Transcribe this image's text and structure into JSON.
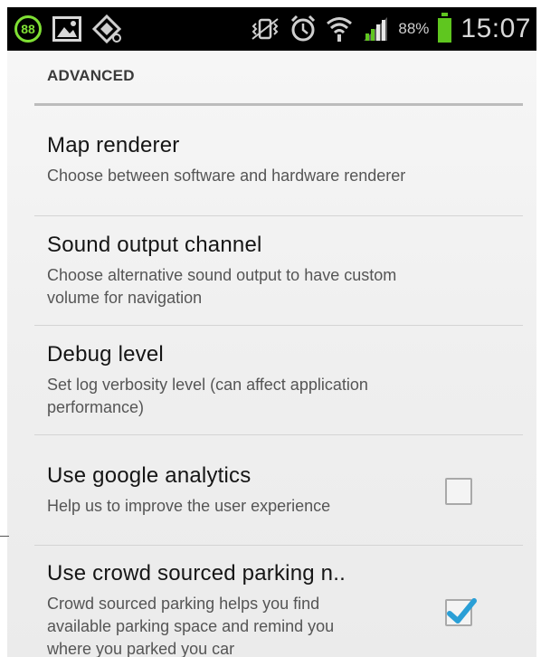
{
  "status_bar": {
    "notification_badge": "88",
    "battery_percent": "88%",
    "time": "15:07",
    "icons": [
      "notification-88-icon",
      "image-icon",
      "app-icon",
      "vibrate-mute-icon",
      "alarm-icon",
      "wifi-icon",
      "signal-icon",
      "battery-icon"
    ],
    "colors": {
      "accent_green": "#7fe034",
      "battery_green": "#5fc61f",
      "check_blue": "#2a9fd6"
    }
  },
  "section": {
    "header": "ADVANCED"
  },
  "settings": [
    {
      "title": "Map renderer",
      "summary_lines": [
        "Choose between software and hardware renderer"
      ]
    },
    {
      "title": "Sound output channel",
      "summary_lines": [
        "Choose alternative sound output to have custom",
        "volume for navigation"
      ]
    },
    {
      "title": "Debug level",
      "summary_lines": [
        "Set log verbosity level (can affect application",
        "performance)"
      ]
    },
    {
      "title": "Use google analytics",
      "summary_lines": [
        "Help us to improve the user experience"
      ],
      "checked": false
    },
    {
      "title": "Use crowd sourced parking n..",
      "summary_lines": [
        "Crowd sourced parking helps you find",
        "available parking space and remind you",
        "where you parked you car"
      ],
      "checked": true
    }
  ]
}
